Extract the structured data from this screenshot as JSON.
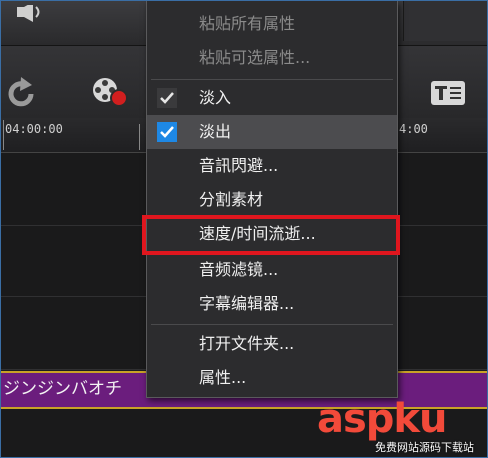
{
  "timeline": {
    "ruler_left": "04:00:00",
    "ruler_right": "4:00",
    "clip_title": "ジンジンバオチ"
  },
  "context_menu": {
    "items": [
      {
        "label": "粘贴所有属性",
        "enabled": false
      },
      {
        "label": "粘贴可选属性...",
        "enabled": false
      },
      {
        "label": "淡入",
        "checked": true,
        "highlighted": false
      },
      {
        "label": "淡出",
        "checked": true,
        "highlighted": true
      },
      {
        "label": "音訊閃避..."
      },
      {
        "label": "分割素材"
      },
      {
        "label": "速度/时间流逝...",
        "annotated": true
      },
      {
        "label": "音频滤镜..."
      },
      {
        "label": "字幕编辑器..."
      },
      {
        "label": "打开文件夹..."
      },
      {
        "label": "属性..."
      }
    ]
  },
  "watermark": {
    "logo": "aspku",
    "subtitle": "免费网站源码下载站"
  },
  "colors": {
    "menu_bg": "#2c2c2e",
    "highlight": "#4c4c4f",
    "check_blue": "#1e88e5",
    "annotation_red": "#e0161e",
    "clip_purple": "#6b1d7d"
  }
}
